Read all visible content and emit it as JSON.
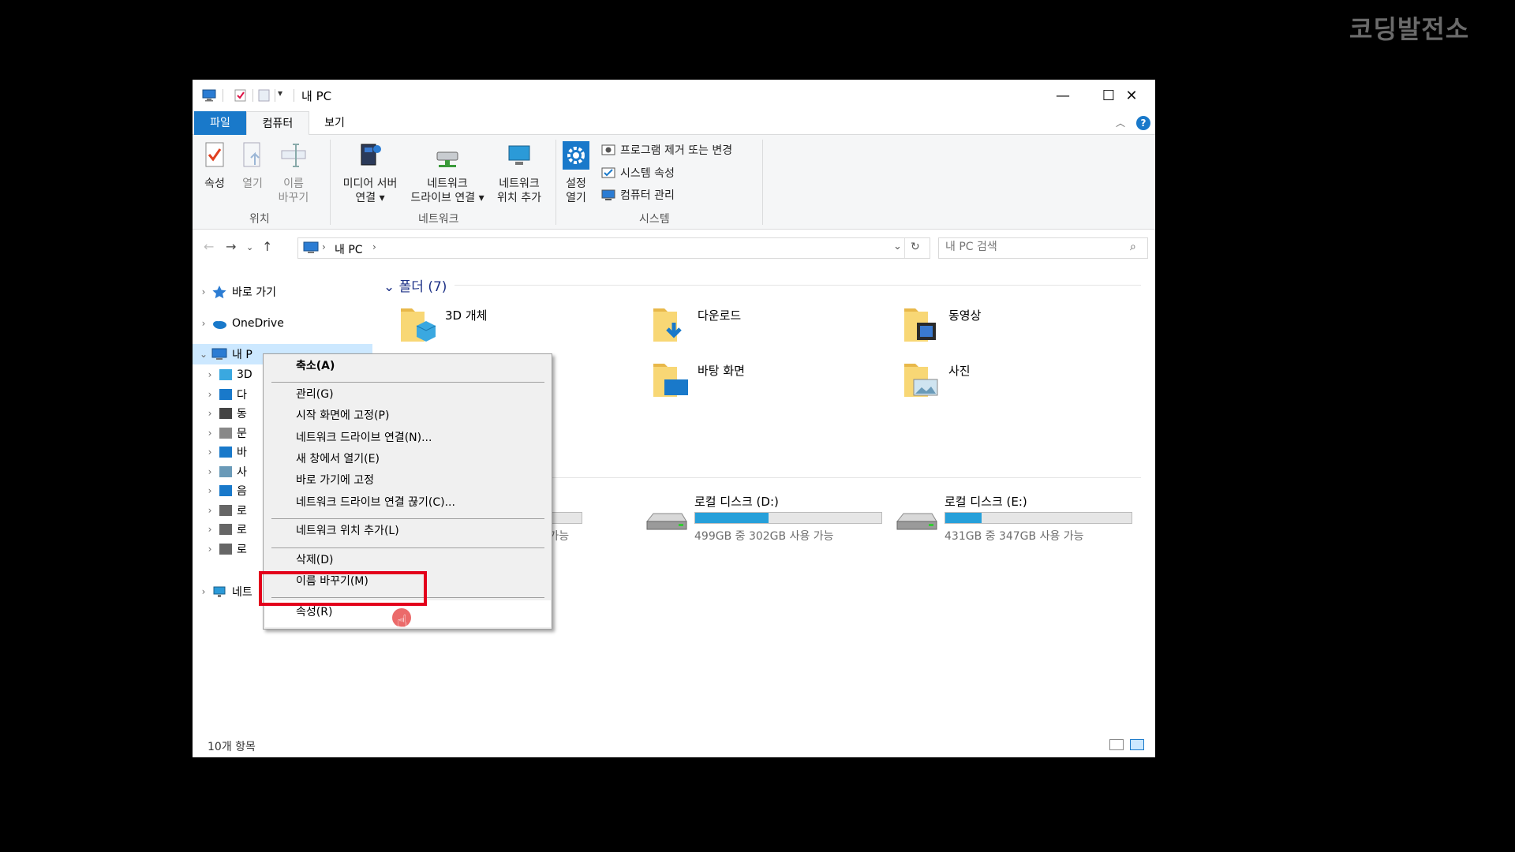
{
  "watermark": "코딩발전소",
  "window": {
    "title": "내 PC",
    "controls": {
      "minimize": "—",
      "maximize": "☐",
      "close": "✕"
    }
  },
  "ribbon_tabs": {
    "file": "파일",
    "computer": "컴퓨터",
    "view": "보기",
    "help": "?"
  },
  "ribbon": {
    "location": {
      "label": "위치",
      "properties": "속성",
      "open": "열기",
      "rename_1": "이름",
      "rename_2": "바꾸기"
    },
    "network": {
      "label": "네트워크",
      "media_1": "미디어 서버",
      "media_2": "연결",
      "map_1": "네트워크",
      "map_2": "드라이브 연결",
      "addloc_1": "네트워크",
      "addloc_2": "위치 추가"
    },
    "system": {
      "label": "시스템",
      "settings_1": "설정",
      "settings_2": "열기",
      "uninstall": "프로그램 제거 또는 변경",
      "sysprops": "시스템 속성",
      "manage": "컴퓨터 관리"
    }
  },
  "address": {
    "path": "내 PC",
    "search_placeholder": "내 PC 검색"
  },
  "navpane": {
    "quick_access": "바로 가기",
    "onedrive": "OneDrive",
    "this_pc": "내 P",
    "children": [
      "3D",
      "다",
      "동",
      "문",
      "바",
      "사",
      "음",
      "로",
      "로",
      "로"
    ],
    "network": "네트"
  },
  "content": {
    "folders_header": "폴더 (7)",
    "folders": [
      {
        "name": "3D 개체",
        "icon": "3d-objects-folder-icon"
      },
      {
        "name": "다운로드",
        "icon": "downloads-folder-icon"
      },
      {
        "name": "동영상",
        "icon": "videos-folder-icon"
      },
      {
        "name": "바탕 화면",
        "icon": "desktop-folder-icon"
      },
      {
        "name": "사진",
        "icon": "pictures-folder-icon"
      }
    ],
    "drives": [
      {
        "name": "",
        "info": "용 가능",
        "fill": 0.3
      },
      {
        "name": "로컬 디스크 (D:)",
        "info": "499GB 중 302GB 사용 가능",
        "fill": 0.395
      },
      {
        "name": "로컬 디스크 (E:)",
        "info": "431GB 중 347GB 사용 가능",
        "fill": 0.195
      }
    ]
  },
  "status": {
    "item_count": "10개 항목"
  },
  "context_menu": {
    "collapse": "축소(A)",
    "manage": "관리(G)",
    "pin_start": "시작 화면에 고정(P)",
    "map_drive": "네트워크 드라이브 연결(N)...",
    "open_new": "새 창에서 열기(E)",
    "pin_quick": "바로 가기에 고정",
    "disconnect": "네트워크 드라이브 연결 끊기(C)...",
    "add_netloc": "네트워크 위치 추가(L)",
    "delete": "삭제(D)",
    "rename": "이름 바꾸기(M)",
    "properties": "속성(R)"
  },
  "colors": {
    "accent": "#1979ca",
    "highlight": "#e3001b",
    "drive_fill": "#26a0da"
  }
}
